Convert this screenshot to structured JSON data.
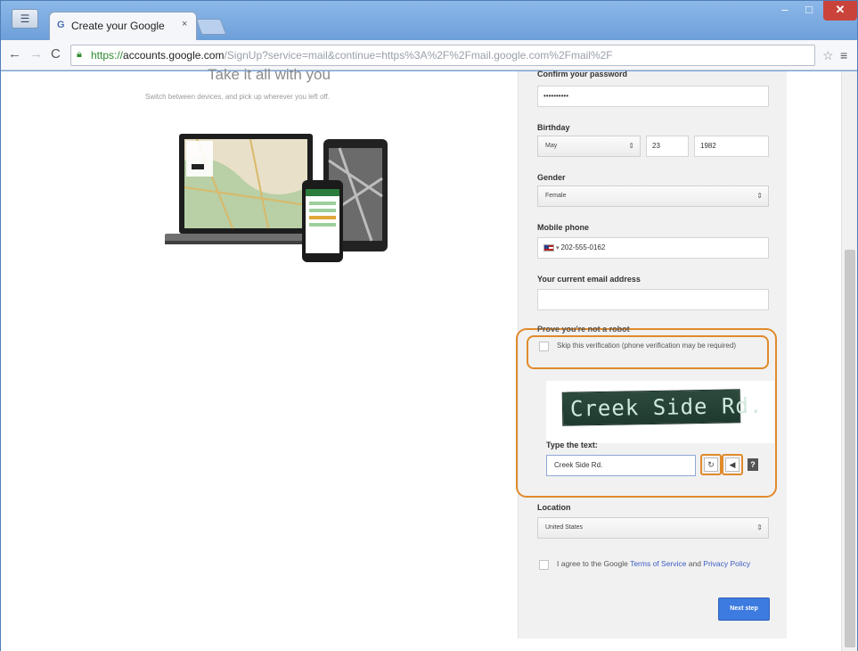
{
  "browser": {
    "app_menu_icon": "chrome-menu-icon",
    "tab_title": "Create your Google",
    "tab_close": "×",
    "url_scheme": "https://",
    "url_host": "accounts.google.com",
    "url_path": "/SignUp?service=mail&continue=https%3A%2F%2Fmail.google.com%2Fmail%2F",
    "window_buttons": {
      "minimize": "–",
      "maximize": "□",
      "close": "✕"
    }
  },
  "promo": {
    "title": "Take it all with you",
    "subtitle": "Switch between devices, and pick up wherever you left off."
  },
  "form": {
    "confirm_password": {
      "label": "Confirm your password",
      "value": "••••••••••"
    },
    "birthday": {
      "label": "Birthday",
      "month": "May",
      "day": "23",
      "year": "1982"
    },
    "gender": {
      "label": "Gender",
      "value": "Female"
    },
    "mobile_phone": {
      "label": "Mobile phone",
      "country": "US",
      "value": "202-555-0162"
    },
    "current_email": {
      "label": "Your current email address",
      "value": ""
    },
    "robot": {
      "label": "Prove you're not a robot",
      "skip_text": "Skip this verification (phone verification may be required)"
    },
    "captcha": {
      "image_text": "Creek Side Rd.",
      "type_label": "Type the text:",
      "value": "Creek Side Rd.",
      "refresh_icon": "refresh-icon",
      "audio_icon": "speaker-icon",
      "help_icon": "?"
    },
    "location": {
      "label": "Location",
      "value": "United States"
    },
    "tos": {
      "prefix": "I agree to the Google ",
      "terms_link": "Terms of Service",
      "middle": " and ",
      "privacy_link": "Privacy Policy"
    },
    "next_button": "Next step"
  },
  "colors": {
    "highlight": "#e08a2c",
    "button_blue": "#3d7be0",
    "link_blue": "#3b5cc4",
    "panel_bg": "#f1f1f1"
  }
}
